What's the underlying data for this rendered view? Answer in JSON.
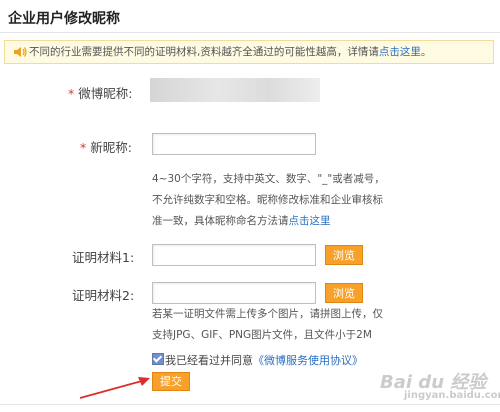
{
  "page": {
    "title": "企业用户修改昵称"
  },
  "notice": {
    "text": "不同的行业需要提供不同的证明材料,资料越齐全通过的可能性越高，详情请",
    "link": "点击这里",
    "end": "。",
    "icon": "speaker-icon"
  },
  "form": {
    "current_nickname_label": "微博昵称:",
    "new_nickname_label": "新昵称:",
    "new_nickname_value": "",
    "nickname_hint": {
      "line1": "4~30个字符，支持中英文、数字、\"_\"或者减号，",
      "line2": "不允许纯数字和空格。昵称修改标准和企业审核标",
      "line3_prefix": "准一致，具体昵称命名方法请",
      "line3_link": "点击这里"
    },
    "proof1_label": "证明材料1:",
    "proof2_label": "证明材料2:",
    "browse_label": "浏览",
    "upload_hint": {
      "line1": "若某一证明文件需上传多个图片，请拼图上传，仅",
      "line2": "支持JPG、GIF、PNG图片文件，且文件小于2M"
    },
    "agree_text": "我已经看过并同意",
    "agree_link": "《微博服务使用协议》",
    "agree_checked": true,
    "submit_label": "提交"
  },
  "watermark": {
    "main": "Bai du 经验",
    "sub": "jingyan.baidu.com"
  },
  "colors": {
    "accent_orange": "#f8a12a",
    "link_blue": "#2a6fc1",
    "required_red": "#d43c2c",
    "arrow_red": "#d9302a"
  }
}
